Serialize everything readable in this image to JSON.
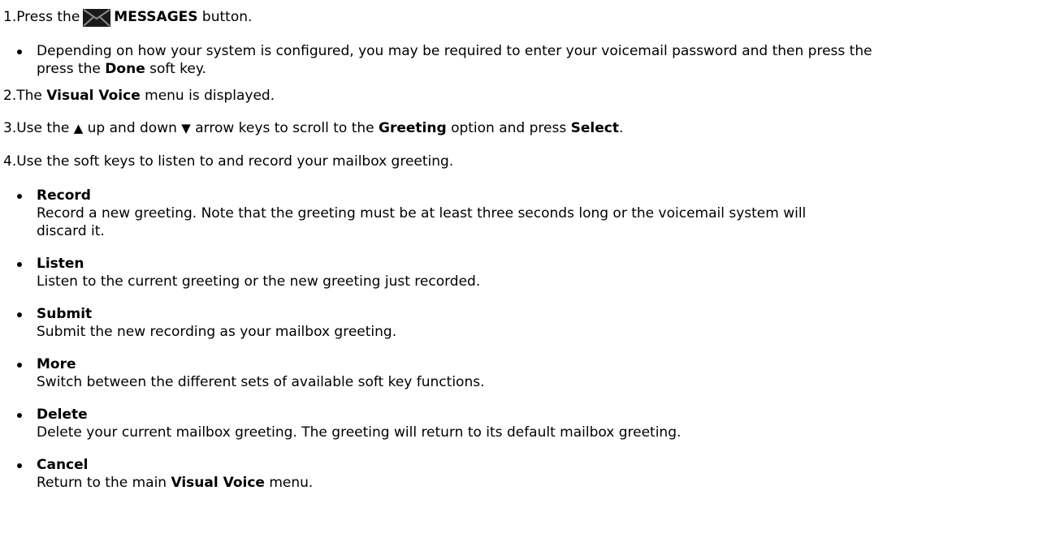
{
  "step1": {
    "num": "1.",
    "pre": "Press the",
    "button": "MESSAGES",
    "post": "button.",
    "icon": "envelope-icon",
    "note": {
      "pre": "Depending on how your system is configured, you may be required to enter your voicemail password and then press the",
      "key": "Done",
      "post": "soft key."
    }
  },
  "step2": {
    "num": "2.",
    "pre": "The",
    "menu": "Visual Voice",
    "post": "menu is displayed."
  },
  "step3": {
    "num": "3.",
    "a": "Use the",
    "b": "up and down",
    "c": "arrow keys to scroll to the",
    "option": "Greeting",
    "d": "option and press",
    "select": "Select",
    "e": "."
  },
  "step4": {
    "num": "4.",
    "text": "Use the soft keys to listen to and record your mailbox greeting.",
    "items": [
      {
        "label": "Record",
        "desc": "Record a new greeting. Note that the greeting must be at least three seconds long or the voicemail system will",
        "desc2": "discard it."
      },
      {
        "label": "Listen",
        "desc": "Listen to the current greeting or the new greeting just recorded."
      },
      {
        "label": "Submit",
        "desc": "Submit the new recording as your mailbox greeting."
      },
      {
        "label": "More",
        "desc": "Switch between the different sets of available soft key functions."
      },
      {
        "label": "Delete",
        "desc": "Delete your current mailbox greeting. The greeting will return to its default mailbox greeting."
      },
      {
        "label": "Cancel",
        "desc_pre": "Return to the main",
        "desc_menu": "Visual Voice",
        "desc_post": "menu."
      }
    ]
  }
}
